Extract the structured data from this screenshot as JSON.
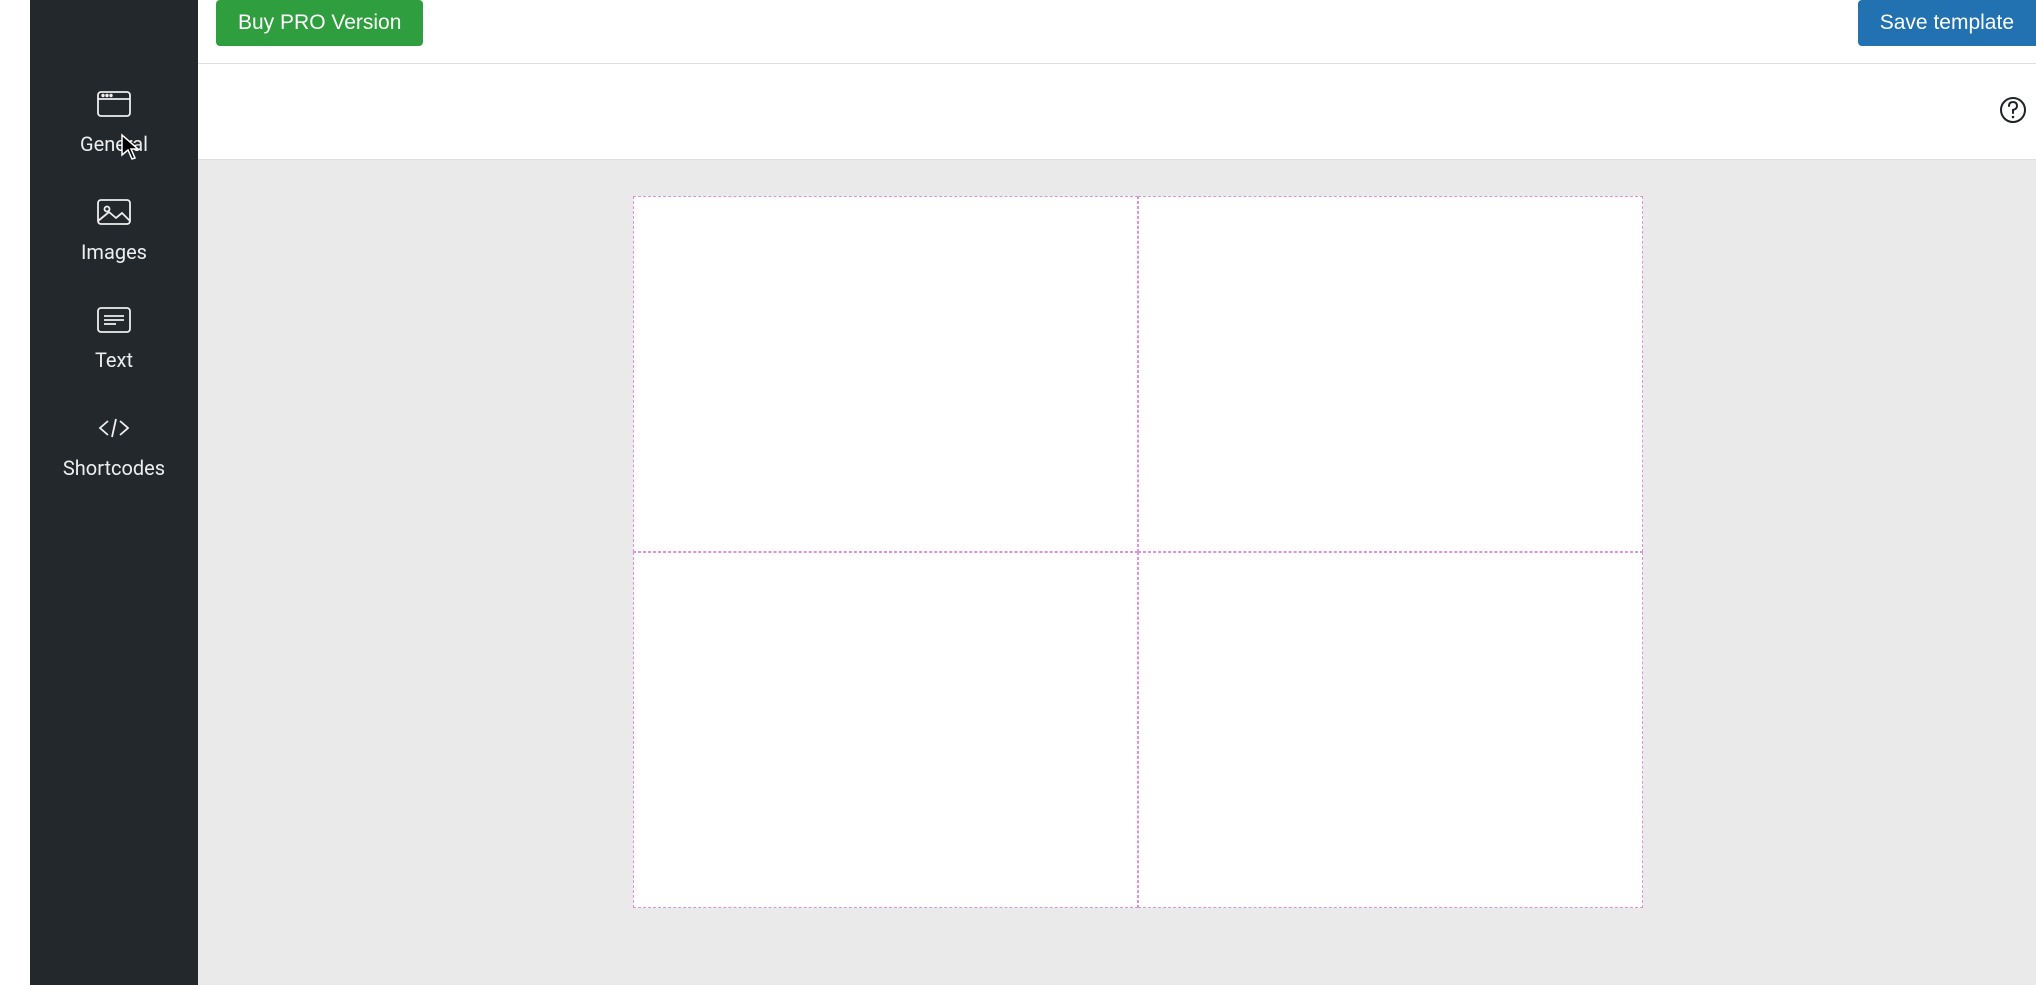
{
  "header": {
    "buy_pro_label": "Buy PRO Version",
    "save_template_label": "Save template"
  },
  "sidebar": {
    "items": [
      {
        "label": "General",
        "icon": "window"
      },
      {
        "label": "Images",
        "icon": "image"
      },
      {
        "label": "Text",
        "icon": "text-lines"
      },
      {
        "label": "Shortcodes",
        "icon": "code"
      }
    ]
  },
  "canvas": {
    "grid": {
      "rows": 2,
      "cols": 2
    }
  },
  "colors": {
    "sidebar_bg": "#23282d",
    "btn_green": "#2e9e3e",
    "btn_blue": "#2271b1",
    "canvas_bg": "#eaeaea",
    "cell_border": "#d896d8"
  }
}
